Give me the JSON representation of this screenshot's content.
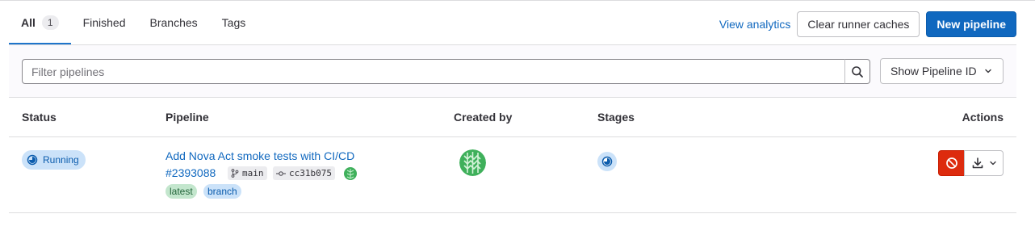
{
  "tabs": [
    {
      "label": "All",
      "count": "1"
    },
    {
      "label": "Finished"
    },
    {
      "label": "Branches"
    },
    {
      "label": "Tags"
    }
  ],
  "actions": {
    "analytics": "View analytics",
    "clear_caches": "Clear runner caches",
    "new_pipeline": "New pipeline"
  },
  "filter": {
    "placeholder": "Filter pipelines",
    "pipeline_id_dropdown": "Show Pipeline ID"
  },
  "table": {
    "headers": {
      "status": "Status",
      "pipeline": "Pipeline",
      "created_by": "Created by",
      "stages": "Stages",
      "actions": "Actions"
    },
    "rows": [
      {
        "status": "Running",
        "title": "Add Nova Act smoke tests with CI/CD",
        "id": "#2393088",
        "branch": "main",
        "commit": "cc31b075",
        "tags": [
          "latest",
          "branch"
        ]
      }
    ]
  },
  "colors": {
    "accent": "#1068bf",
    "running_badge_bg": "#cbe2f9",
    "cancel": "#dd2b0e",
    "avatar": "#3fb05b"
  }
}
